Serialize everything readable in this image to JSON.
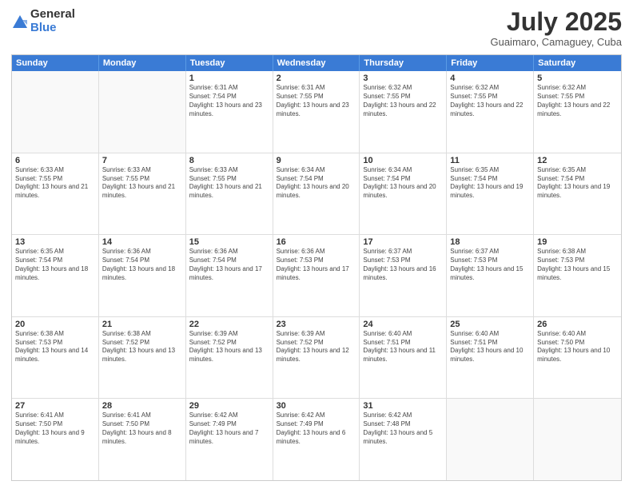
{
  "header": {
    "logo_general": "General",
    "logo_blue": "Blue",
    "month_title": "July 2025",
    "subtitle": "Guaimaro, Camaguey, Cuba"
  },
  "calendar": {
    "weekdays": [
      "Sunday",
      "Monday",
      "Tuesday",
      "Wednesday",
      "Thursday",
      "Friday",
      "Saturday"
    ],
    "rows": [
      [
        {
          "day": "",
          "info": ""
        },
        {
          "day": "",
          "info": ""
        },
        {
          "day": "1",
          "info": "Sunrise: 6:31 AM\nSunset: 7:54 PM\nDaylight: 13 hours and 23 minutes."
        },
        {
          "day": "2",
          "info": "Sunrise: 6:31 AM\nSunset: 7:55 PM\nDaylight: 13 hours and 23 minutes."
        },
        {
          "day": "3",
          "info": "Sunrise: 6:32 AM\nSunset: 7:55 PM\nDaylight: 13 hours and 22 minutes."
        },
        {
          "day": "4",
          "info": "Sunrise: 6:32 AM\nSunset: 7:55 PM\nDaylight: 13 hours and 22 minutes."
        },
        {
          "day": "5",
          "info": "Sunrise: 6:32 AM\nSunset: 7:55 PM\nDaylight: 13 hours and 22 minutes."
        }
      ],
      [
        {
          "day": "6",
          "info": "Sunrise: 6:33 AM\nSunset: 7:55 PM\nDaylight: 13 hours and 21 minutes."
        },
        {
          "day": "7",
          "info": "Sunrise: 6:33 AM\nSunset: 7:55 PM\nDaylight: 13 hours and 21 minutes."
        },
        {
          "day": "8",
          "info": "Sunrise: 6:33 AM\nSunset: 7:55 PM\nDaylight: 13 hours and 21 minutes."
        },
        {
          "day": "9",
          "info": "Sunrise: 6:34 AM\nSunset: 7:54 PM\nDaylight: 13 hours and 20 minutes."
        },
        {
          "day": "10",
          "info": "Sunrise: 6:34 AM\nSunset: 7:54 PM\nDaylight: 13 hours and 20 minutes."
        },
        {
          "day": "11",
          "info": "Sunrise: 6:35 AM\nSunset: 7:54 PM\nDaylight: 13 hours and 19 minutes."
        },
        {
          "day": "12",
          "info": "Sunrise: 6:35 AM\nSunset: 7:54 PM\nDaylight: 13 hours and 19 minutes."
        }
      ],
      [
        {
          "day": "13",
          "info": "Sunrise: 6:35 AM\nSunset: 7:54 PM\nDaylight: 13 hours and 18 minutes."
        },
        {
          "day": "14",
          "info": "Sunrise: 6:36 AM\nSunset: 7:54 PM\nDaylight: 13 hours and 18 minutes."
        },
        {
          "day": "15",
          "info": "Sunrise: 6:36 AM\nSunset: 7:54 PM\nDaylight: 13 hours and 17 minutes."
        },
        {
          "day": "16",
          "info": "Sunrise: 6:36 AM\nSunset: 7:53 PM\nDaylight: 13 hours and 17 minutes."
        },
        {
          "day": "17",
          "info": "Sunrise: 6:37 AM\nSunset: 7:53 PM\nDaylight: 13 hours and 16 minutes."
        },
        {
          "day": "18",
          "info": "Sunrise: 6:37 AM\nSunset: 7:53 PM\nDaylight: 13 hours and 15 minutes."
        },
        {
          "day": "19",
          "info": "Sunrise: 6:38 AM\nSunset: 7:53 PM\nDaylight: 13 hours and 15 minutes."
        }
      ],
      [
        {
          "day": "20",
          "info": "Sunrise: 6:38 AM\nSunset: 7:53 PM\nDaylight: 13 hours and 14 minutes."
        },
        {
          "day": "21",
          "info": "Sunrise: 6:38 AM\nSunset: 7:52 PM\nDaylight: 13 hours and 13 minutes."
        },
        {
          "day": "22",
          "info": "Sunrise: 6:39 AM\nSunset: 7:52 PM\nDaylight: 13 hours and 13 minutes."
        },
        {
          "day": "23",
          "info": "Sunrise: 6:39 AM\nSunset: 7:52 PM\nDaylight: 13 hours and 12 minutes."
        },
        {
          "day": "24",
          "info": "Sunrise: 6:40 AM\nSunset: 7:51 PM\nDaylight: 13 hours and 11 minutes."
        },
        {
          "day": "25",
          "info": "Sunrise: 6:40 AM\nSunset: 7:51 PM\nDaylight: 13 hours and 10 minutes."
        },
        {
          "day": "26",
          "info": "Sunrise: 6:40 AM\nSunset: 7:50 PM\nDaylight: 13 hours and 10 minutes."
        }
      ],
      [
        {
          "day": "27",
          "info": "Sunrise: 6:41 AM\nSunset: 7:50 PM\nDaylight: 13 hours and 9 minutes."
        },
        {
          "day": "28",
          "info": "Sunrise: 6:41 AM\nSunset: 7:50 PM\nDaylight: 13 hours and 8 minutes."
        },
        {
          "day": "29",
          "info": "Sunrise: 6:42 AM\nSunset: 7:49 PM\nDaylight: 13 hours and 7 minutes."
        },
        {
          "day": "30",
          "info": "Sunrise: 6:42 AM\nSunset: 7:49 PM\nDaylight: 13 hours and 6 minutes."
        },
        {
          "day": "31",
          "info": "Sunrise: 6:42 AM\nSunset: 7:48 PM\nDaylight: 13 hours and 5 minutes."
        },
        {
          "day": "",
          "info": ""
        },
        {
          "day": "",
          "info": ""
        }
      ]
    ]
  }
}
